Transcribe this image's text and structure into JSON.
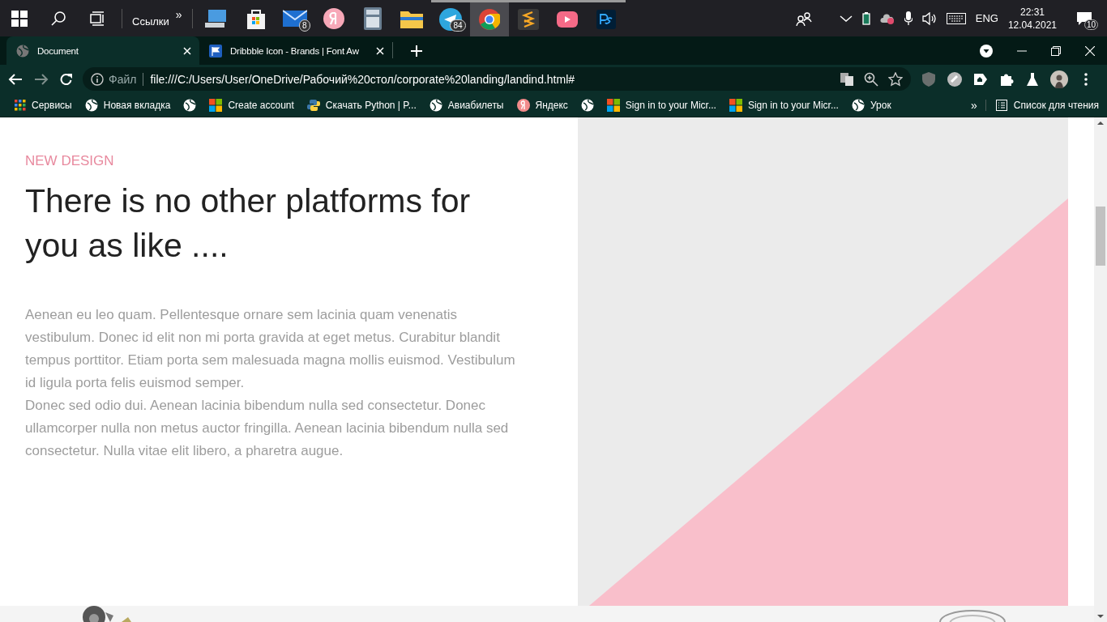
{
  "taskbar": {
    "links_label": "Ссылки",
    "links_more": "»",
    "apps": [
      {
        "running": false,
        "selected": false
      },
      {
        "running": false,
        "selected": false
      },
      {
        "running": false,
        "selected": false,
        "badge": "8"
      },
      {
        "running": false,
        "selected": false
      },
      {
        "running": false,
        "selected": false
      },
      {
        "running": false,
        "selected": false
      },
      {
        "running": true,
        "selected": false,
        "badge": "84"
      },
      {
        "running": true,
        "selected": true
      },
      {
        "running": true,
        "selected": false
      },
      {
        "running": true,
        "selected": false
      },
      {
        "running": true,
        "selected": false
      }
    ],
    "language": "ENG",
    "time": "22:31",
    "date": "12.04.2021",
    "notifications": "10"
  },
  "tabs": [
    {
      "title": "Document",
      "selected": true
    },
    {
      "title": "Dribbble Icon - Brands | Font Aw",
      "selected": false
    }
  ],
  "address_bar": {
    "scheme_label": "Файл",
    "url": "file:///C:/Users/User/OneDrive/Рабочий%20стол/corporate%20landing/landind.html#"
  },
  "bookmarks": [
    {
      "label": "Сервисы"
    },
    {
      "label": "Новая вкладка"
    },
    {
      "kind": "icon"
    },
    {
      "label": "Create account"
    },
    {
      "label": "Скачать Python | P..."
    },
    {
      "label": "Авиабилеты"
    },
    {
      "label": "Яндекс"
    },
    {
      "kind": "icon"
    },
    {
      "label": "Sign in to your Micr..."
    },
    {
      "label": "Sign in to your Micr..."
    },
    {
      "label": "Урок"
    }
  ],
  "bookmarks_more": "»",
  "reading_list": "Список для чтения",
  "page": {
    "eyebrow": "NEW DESIGN",
    "heading": "There is no other platforms for you as like ....",
    "paragraphs": [
      "Aenean eu leo quam. Pellentesque ornare sem lacinia quam venenatis vestibulum. Donec id elit non mi porta gravida at eget metus. Curabitur blandit tempus porttitor. Etiam porta sem malesuada magna mollis euismod. Vestibulum id ligula porta felis euismod semper.",
      "Donec sed odio dui. Aenean lacinia bibendum nulla sed consectetur. Donec ullamcorper nulla non metus auctor fringilla. Aenean lacinia bibendum nulla sed consectetur. Nulla vitae elit libero, a pharetra augue."
    ]
  }
}
